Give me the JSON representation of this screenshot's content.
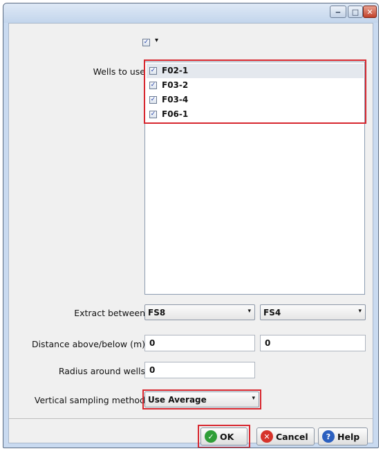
{
  "window": {
    "minimize_glyph": "‒",
    "maximize_glyph": "□",
    "close_glyph": "✕"
  },
  "top_toggle": {
    "checked": true,
    "check_glyph": "✓",
    "arrow_glyph": "▾"
  },
  "wells": {
    "label": "Wells to use",
    "items": [
      {
        "name": "F02-1",
        "checked": true
      },
      {
        "name": "F03-2",
        "checked": true
      },
      {
        "name": "F03-4",
        "checked": true
      },
      {
        "name": "F06-1",
        "checked": true
      }
    ]
  },
  "extract": {
    "label": "Extract between",
    "from": "FS8",
    "to": "FS4"
  },
  "distance": {
    "label": "Distance above/below (m)",
    "above": "0",
    "below": "0"
  },
  "radius": {
    "label": "Radius around wells",
    "value": "0"
  },
  "vertical_sampling": {
    "label": "Vertical sampling method",
    "value": "Use Average"
  },
  "buttons": {
    "ok": "OK",
    "cancel": "Cancel",
    "help": "Help"
  },
  "colors": {
    "highlight": "#d7262e",
    "ok_icon": "#2f9e37",
    "cancel_icon": "#d6332a",
    "help_icon": "#2b5fbf"
  }
}
